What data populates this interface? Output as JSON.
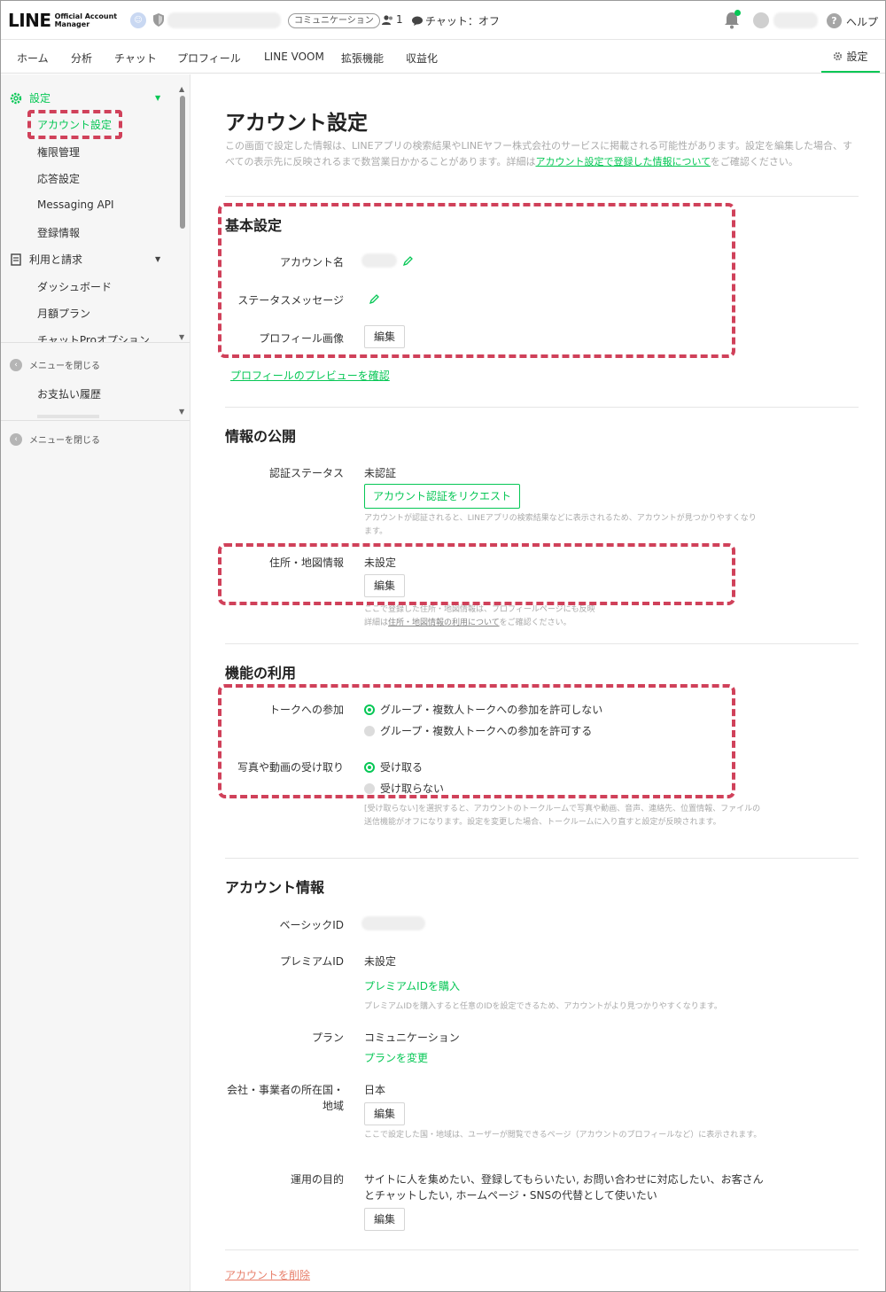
{
  "header": {
    "logo_main": "LINE",
    "logo_sub_1": "Official Account",
    "logo_sub_2": "Manager",
    "plan_badge": "コミュニケーション",
    "friends_count": "1",
    "chat_status": "チャット：オフ",
    "help_label": "ヘルプ"
  },
  "nav": {
    "items": [
      "ホーム",
      "分析",
      "チャット",
      "プロフィール",
      "LINE VOOM",
      "拡張機能",
      "収益化"
    ],
    "settings_label": "設定"
  },
  "sidebar": {
    "group_settings": "設定",
    "settings_items": [
      "アカウント設定",
      "権限管理",
      "応答設定",
      "Messaging API",
      "登録情報"
    ],
    "group_billing": "利用と請求",
    "billing_items": [
      "ダッシュボード",
      "月額プラン",
      "チャットProオプション"
    ],
    "close_menu": "メニューを閉じる",
    "payment_history": "お支払い履歴"
  },
  "page": {
    "title": "アカウント設定",
    "desc_before": "この画面で設定した情報は、LINEアプリの検索結果やLINEヤフー株式会社のサービスに掲載される可能性があります。設定を編集した場合、すべての表示先に反映されるまで数営業日かかることがあります。詳細は",
    "desc_link": "アカウント設定で登録した情報について",
    "desc_after": "をご確認ください。"
  },
  "basic": {
    "title": "基本設定",
    "account_name_label": "アカウント名",
    "status_message_label": "ステータスメッセージ",
    "profile_image_label": "プロフィール画像",
    "edit_label": "編集",
    "preview_link": "プロフィールのプレビューを確認"
  },
  "disclosure": {
    "title": "情報の公開",
    "verify_label": "認証ステータス",
    "verify_value": "未認証",
    "verify_button": "アカウント認証をリクエスト",
    "verify_note": "アカウントが認証されると、LINEアプリの検索結果などに表示されるため、アカウントが見つかりやすくなります。",
    "address_label": "住所・地図情報",
    "address_value": "未設定",
    "edit_label": "編集",
    "address_note_1": "ここで登録した住所・地図情報は、プロフィールページにも反映",
    "address_note_2a": "詳細は",
    "address_note_2b": "住所・地図情報の利用について",
    "address_note_2c": "をご確認ください。"
  },
  "features": {
    "title": "機能の利用",
    "talk_label": "トークへの参加",
    "talk_opt1": "グループ・複数人トークへの参加を許可しない",
    "talk_opt2": "グループ・複数人トークへの参加を許可する",
    "media_label": "写真や動画の受け取り",
    "media_opt1": "受け取る",
    "media_opt2": "受け取らない",
    "media_note": "[受け取らない]を選択すると、アカウントのトークルームで写真や動画、音声、連絡先、位置情報、ファイルの送信機能がオフになります。設定を変更した場合、トークルームに入り直すと設定が反映されます。"
  },
  "account_info": {
    "title": "アカウント情報",
    "basic_id_label": "ベーシックID",
    "premium_id_label": "プレミアムID",
    "premium_id_value": "未設定",
    "premium_link": "プレミアムIDを購入",
    "premium_note": "プレミアムIDを購入すると任意のIDを設定できるため、アカウントがより見つかりやすくなります。",
    "plan_label": "プラン",
    "plan_value": "コミュニケーション",
    "plan_link": "プランを変更",
    "country_label_1": "会社・事業者の所在国・",
    "country_label_2": "地域",
    "country_value": "日本",
    "edit_label": "編集",
    "country_note": "ここで設定した国・地域は、ユーザーが閲覧できるページ（アカウントのプロフィールなど）に表示されます。",
    "purpose_label": "運用の目的",
    "purpose_line1": "サイトに人を集めたい、登録してもらいたい, お問い合わせに対応したい、お客さん",
    "purpose_line2": "とチャットしたい, ホームページ・SNSの代替として使いたい",
    "delete_link": "アカウントを削除"
  },
  "colors": {
    "accent": "#06c755",
    "highlight": "#d0415a",
    "delete": "#e8806c"
  }
}
